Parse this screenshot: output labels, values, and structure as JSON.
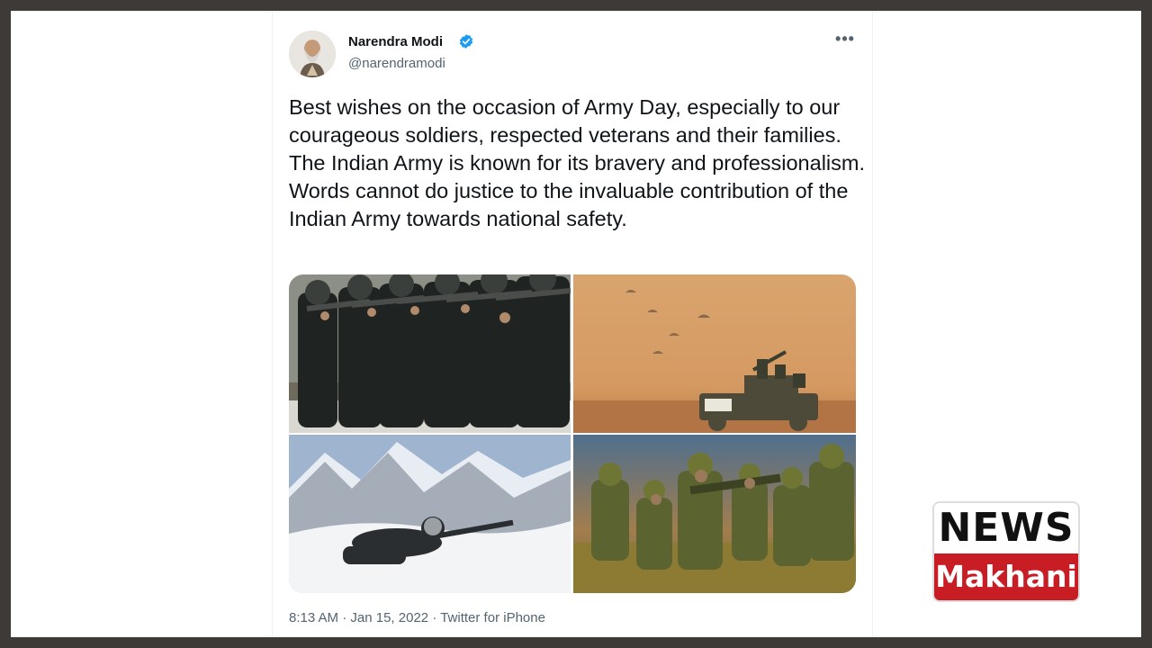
{
  "tweet": {
    "author": {
      "name": "Narendra Modi",
      "handle": "@narendramodi",
      "verified": true
    },
    "more_label": "•••",
    "text": "Best wishes on the occasion of Army Day, especially to our courageous soldiers, respected veterans and their families. The Indian Army is known for its bravery and professionalism. Words cannot do justice to the invaluable contribution of the Indian Army towards national safety.",
    "time": "8:13 AM",
    "separator": "·",
    "date": "Jan 15, 2022",
    "source": "Twitter for iPhone",
    "photos": [
      "photo-soldiers-aiming",
      "photo-desert-parachutes",
      "photo-snow-mountains",
      "photo-soldiers-field"
    ]
  },
  "watermark": {
    "line1": "NEWS",
    "line2": "Makhani"
  },
  "colors": {
    "text": "#0f1419",
    "secondary": "#536471",
    "verified": "#1d9bf0",
    "logo_red": "#c81d25"
  }
}
